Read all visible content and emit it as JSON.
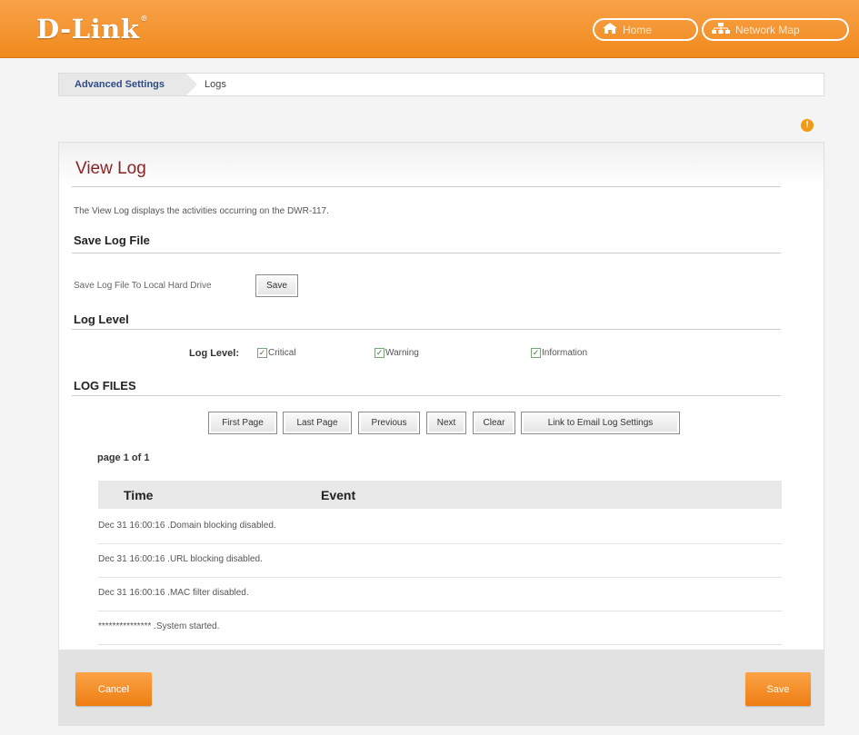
{
  "header": {
    "logo": "D-Link",
    "logo_mark": "®",
    "home_label": "Home",
    "network_map_label": "Network Map"
  },
  "breadcrumb": {
    "parent": "Advanced Settings",
    "current": "Logs"
  },
  "page": {
    "title": "View Log",
    "description": "The View Log displays the activities occurring on the DWR-117."
  },
  "save_section": {
    "heading": "Save Log File",
    "label": "Save Log File To Local Hard Drive",
    "button": "Save"
  },
  "level_section": {
    "heading": "Log Level",
    "label": "Log Level:",
    "options": [
      {
        "label": "Critical",
        "checked": true
      },
      {
        "label": "Warning",
        "checked": true
      },
      {
        "label": "Information",
        "checked": true
      }
    ]
  },
  "files_section": {
    "heading": "LOG FILES",
    "buttons": [
      "First Page",
      "Last Page",
      "Previous",
      "Next",
      "Clear",
      "Link to Email Log Settings"
    ],
    "page_indicator": "page 1 of 1",
    "columns": [
      "Time",
      "Event"
    ],
    "rows": [
      "Dec 31 16:00:16 .Domain blocking disabled.",
      "Dec 31 16:00:16 .URL blocking disabled.",
      "Dec 31 16:00:16 .MAC filter disabled.",
      "*************** .System started."
    ]
  },
  "footer": {
    "cancel": "Cancel",
    "save": "Save"
  }
}
